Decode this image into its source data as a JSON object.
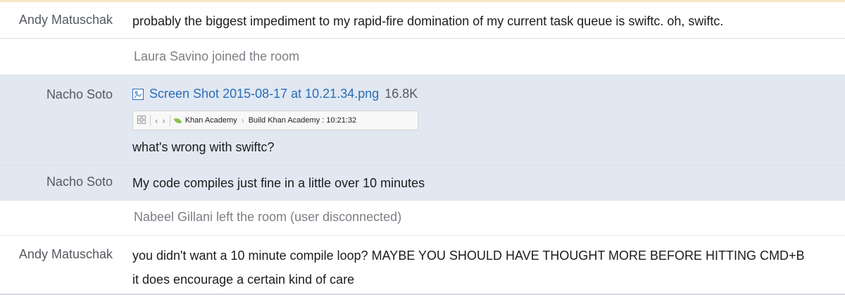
{
  "messages": [
    {
      "sender": "Andy Matuschak",
      "lines": [
        "probably the biggest impediment to my rapid-fire domination of my current task queue is swiftc. oh, swiftc."
      ]
    },
    {
      "system": "Laura Savino joined the room"
    },
    {
      "sender": "Nacho Soto",
      "file": {
        "icon": "image-file-icon",
        "name": "Screen Shot 2015-08-17 at 10.21.34.png",
        "size": "16.8K",
        "preview": {
          "crumb1": "Khan Academy",
          "crumb2": "Build Khan Academy : 10:21:32"
        }
      },
      "lines": [
        "what's wrong with swiftc?"
      ]
    },
    {
      "sender": "Nacho Soto",
      "lines": [
        "My code compiles just fine in a little over 10 minutes"
      ]
    },
    {
      "system": "Nabeel Gillani left the room (user disconnected)"
    },
    {
      "sender": "Andy Matuschak",
      "lines": [
        "you didn't want a 10 minute compile loop? MAYBE YOU SHOULD HAVE THOUGHT MORE BEFORE HITTING CMD+B",
        "it does encourage a certain kind of care"
      ]
    }
  ],
  "colors": {
    "highlight_row": "#e1e8f2",
    "link": "#2a6db5",
    "top_border": "#f7e8c6"
  }
}
